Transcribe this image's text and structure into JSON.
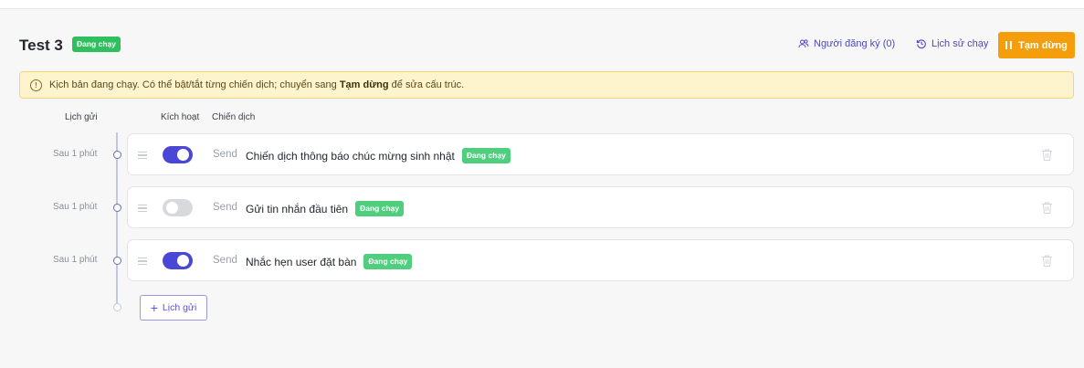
{
  "header": {
    "title": "Test 3",
    "status_badge": "Đang chạy",
    "subscribers_label": "Người đăng ký (0)",
    "history_label": "Lịch sử chạy",
    "pause_label": "Tạm dừng"
  },
  "alert": {
    "text_before": "Kịch bản đang chạy. Có thể bật/tắt từng chiến dịch; chuyển sang ",
    "text_bold": "Tạm dừng",
    "text_after": " để sửa cấu trúc."
  },
  "columns": {
    "schedule": "Lịch gửi",
    "active": "Kích hoạt",
    "campaign": "Chiến dịch"
  },
  "rows": [
    {
      "delay": "Sau 1 phút",
      "active": true,
      "type": "Send",
      "name": "Chiến dịch thông báo chúc mừng sinh nhật",
      "badge": "Đang chạy"
    },
    {
      "delay": "Sau 1 phút",
      "active": false,
      "type": "Send",
      "name": "Gửi tin nhắn đầu tiên",
      "badge": "Đang chạy"
    },
    {
      "delay": "Sau 1 phút",
      "active": true,
      "type": "Send",
      "name": "Nhắc hẹn user đặt bàn",
      "badge": "Đang chạy"
    }
  ],
  "add_schedule_label": "Lịch gửi",
  "icons": {
    "info": "info-circle-icon",
    "users": "users-icon",
    "history": "history-icon",
    "pause": "pause-icon",
    "drag": "drag-handle-icon",
    "trash": "trash-icon",
    "plus": "plus-icon"
  },
  "colors": {
    "accent": "#4a47d6",
    "running": "#3cc36b",
    "pause_button": "#f59e0b",
    "alert_bg": "#fdf3cd"
  }
}
